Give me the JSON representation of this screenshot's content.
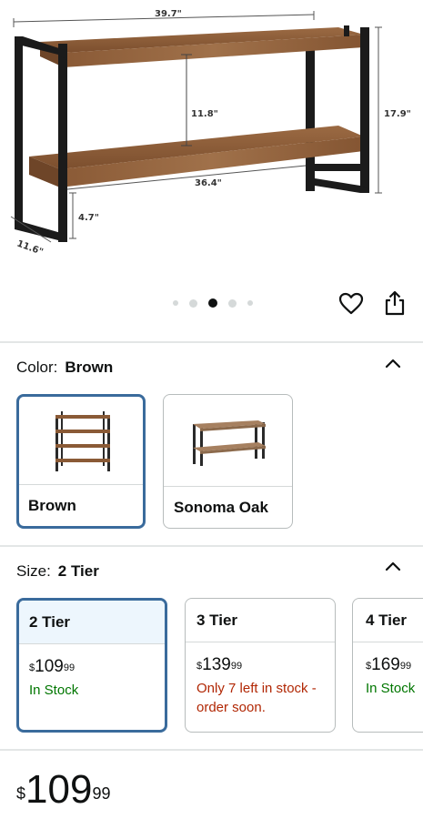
{
  "product_image": {
    "dims": {
      "width": "39.7\"",
      "height": "11.8\"",
      "total_height": "17.9\"",
      "inner_width": "36.4\"",
      "leg": "4.7\"",
      "depth": "11.6\""
    }
  },
  "carousel": {
    "count": 5,
    "active_index": 2
  },
  "actions": {
    "wishlist_icon": "heart-icon",
    "share_icon": "share-icon"
  },
  "color": {
    "label": "Color:",
    "value": "Brown",
    "options": [
      {
        "name": "Brown",
        "selected": true
      },
      {
        "name": "Sonoma Oak",
        "selected": false
      }
    ]
  },
  "size": {
    "label": "Size:",
    "value": "2 Tier",
    "options": [
      {
        "name": "2 Tier",
        "price_symbol": "$",
        "price_whole": "109",
        "price_fraction": "99",
        "availability": "In Stock",
        "selected": true
      },
      {
        "name": "3 Tier",
        "price_symbol": "$",
        "price_whole": "139",
        "price_fraction": "99",
        "availability": "Only 7 left in stock - order soon.",
        "selected": false
      },
      {
        "name": "4 Tier",
        "price_symbol": "$",
        "price_whole": "169",
        "price_fraction": "99",
        "availability": "In Stock",
        "selected": false
      }
    ]
  },
  "price": {
    "symbol": "$",
    "whole": "109",
    "fraction": "99"
  },
  "colors": {
    "selected_border": "#3a6b9c",
    "in_stock": "#007600",
    "low_stock": "#b12704",
    "wood": "#8a5a36"
  }
}
